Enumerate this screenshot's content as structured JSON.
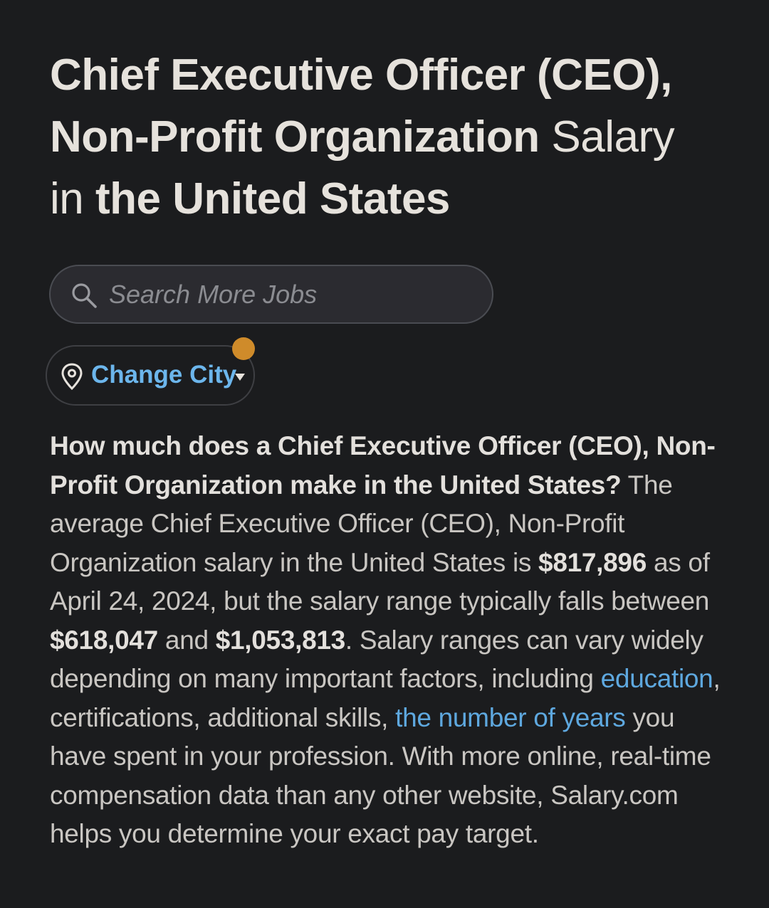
{
  "heading": {
    "job_title": "Chief Executive Officer (CEO), Non-Profit Organization",
    "salary_word": "Salary",
    "in_word": "in",
    "location": "the United States"
  },
  "search": {
    "placeholder": "Search More Jobs",
    "icon": "search-icon"
  },
  "city_selector": {
    "label": "Change City",
    "icon": "location-pin-icon",
    "caret_icon": "caret-down-icon",
    "notification_dot_color": "#cf8b2a"
  },
  "description": {
    "question": "How much does a Chief Executive Officer (CEO), Non-Profit Organization make in the United States?",
    "intro": " The average Chief Executive Officer (CEO), Non-Profit Organization salary in the United States is ",
    "average_salary": "$817,896",
    "as_of": " as of April 24, 2024, but the salary range typically falls between ",
    "range_low": "$618,047",
    "and_word": " and ",
    "range_high": "$1,053,813",
    "factors_text": ". Salary ranges can vary widely depending on many important factors, including ",
    "link_education": "education",
    "certifications_text": ", certifications, additional skills, ",
    "link_years": "the number of years",
    "closing_text": " you have spent in your profession. With more online, real-time compensation data than any other website, Salary.com helps you determine your exact pay target."
  },
  "colors": {
    "background": "#1b1c1e",
    "link": "#5ea8df",
    "accent_blue": "#6cb6ec",
    "dot_orange": "#cf8b2a"
  }
}
